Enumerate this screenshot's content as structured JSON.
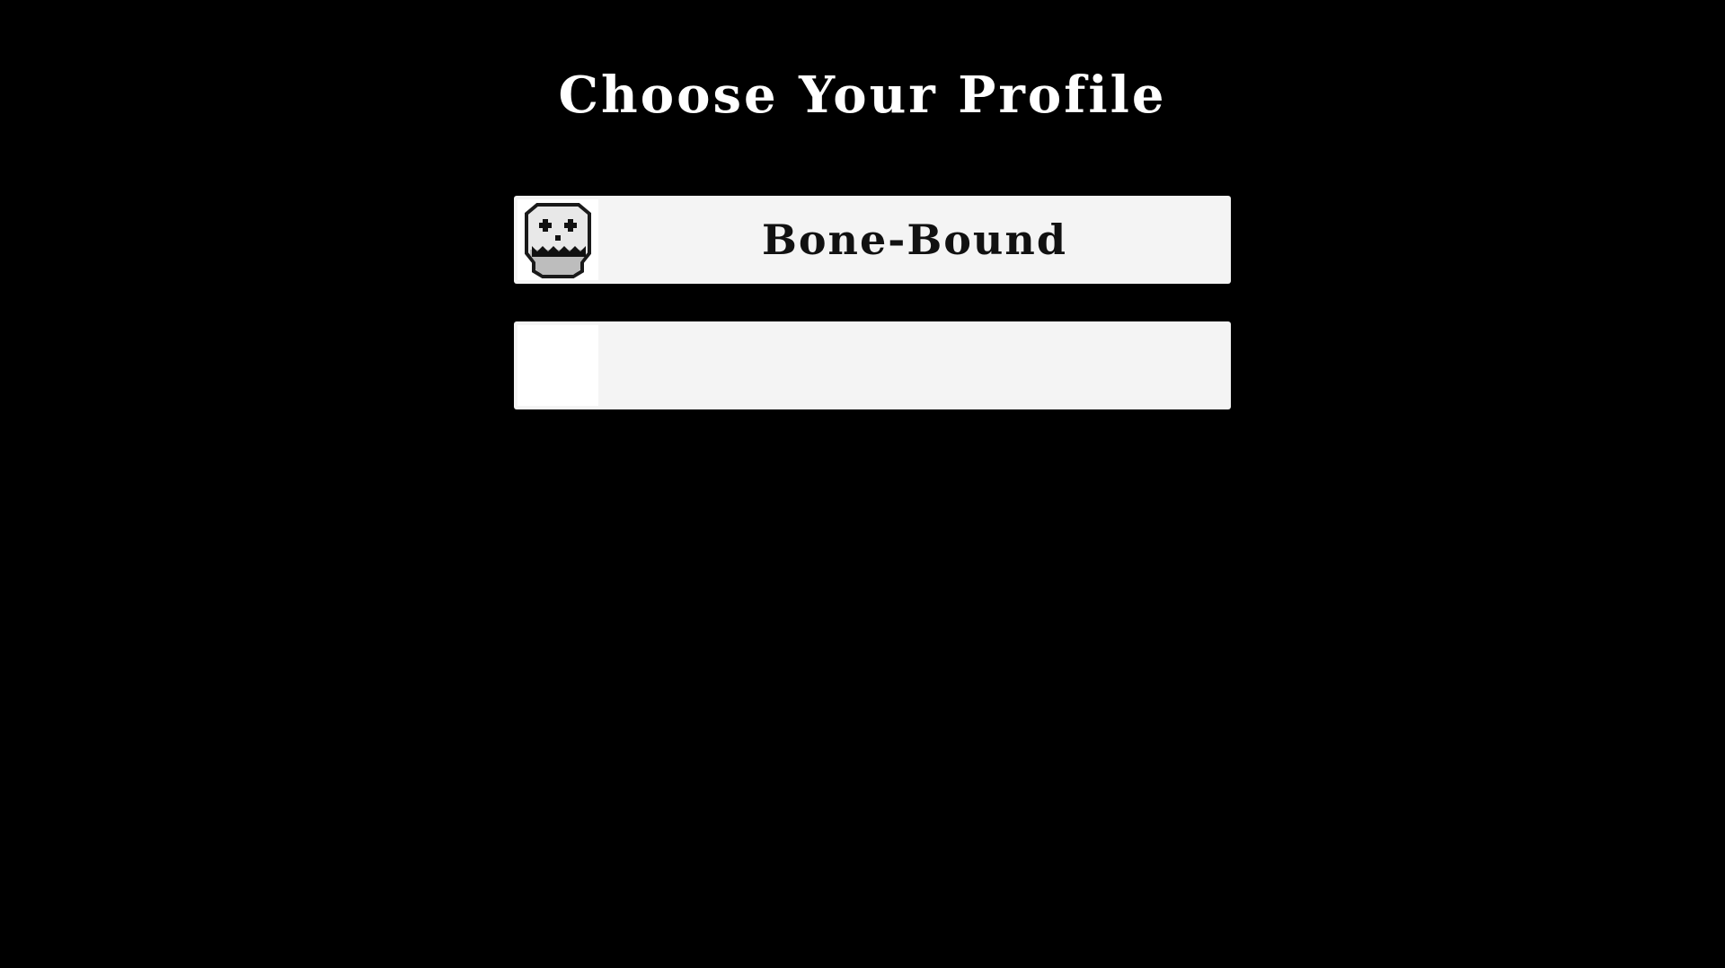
{
  "screen": {
    "title": "Choose Your Profile"
  },
  "profiles": [
    {
      "name": "Bone-Bound",
      "icon": "skull-icon",
      "empty": false
    },
    {
      "name": "",
      "icon": "",
      "empty": true
    }
  ],
  "colors": {
    "background": "#000000",
    "title_text": "#ffffff",
    "slot_background": "#f4f4f4",
    "slot_text": "#111111"
  }
}
